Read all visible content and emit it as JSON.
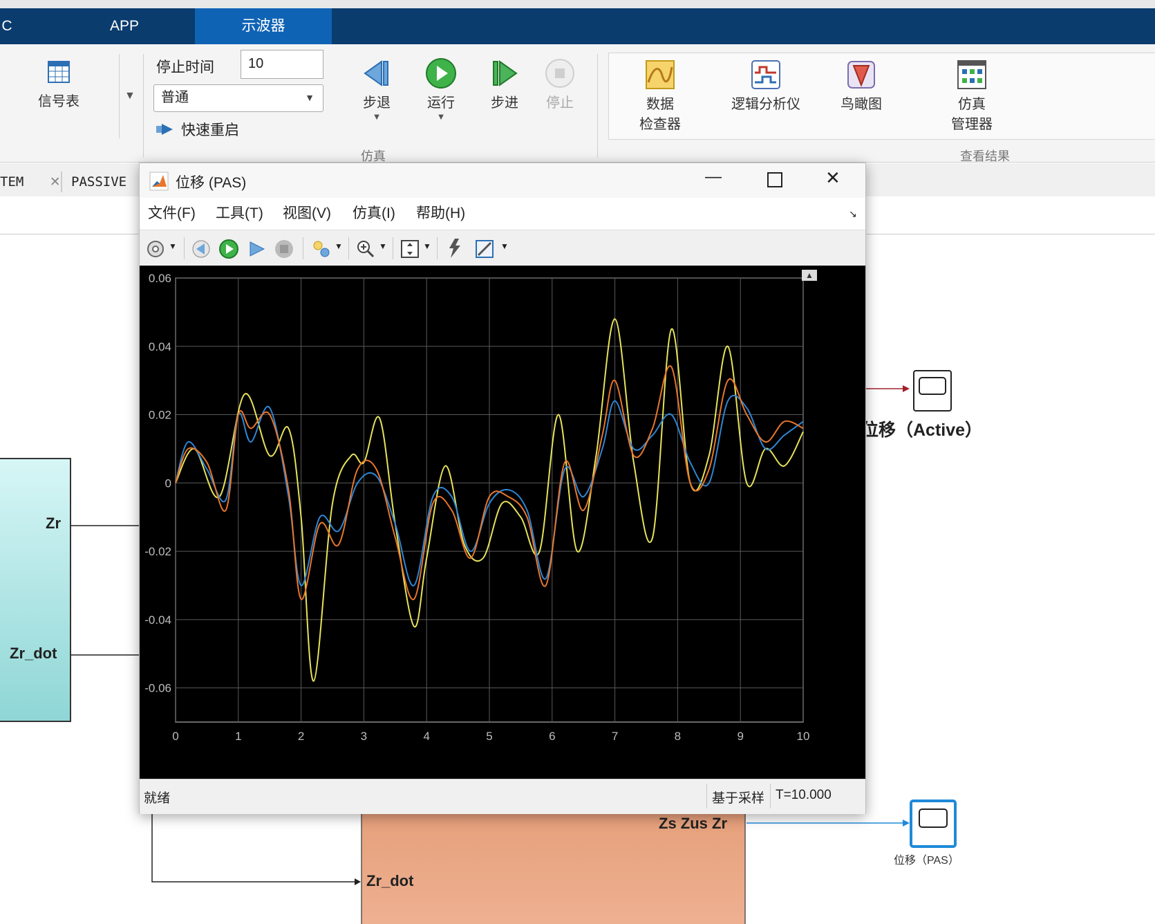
{
  "ribbon": {
    "tabs": [
      {
        "label": "C"
      },
      {
        "label": "APP"
      },
      {
        "label": "示波器",
        "active": true
      }
    ],
    "signal_table_label": "信号表",
    "stop_time_label": "停止时间",
    "stop_time_value": "10",
    "sim_mode_value": "普通",
    "fast_restart_label": "快速重启",
    "step_back_label": "步退",
    "run_label": "运行",
    "step_forward_label": "步进",
    "stop_label": "停止",
    "simulation_group_label": "仿真",
    "data_inspector_label_1": "数据",
    "data_inspector_label_2": "检查器",
    "logic_analyzer_label": "逻辑分析仪",
    "birds_eye_label": "鸟瞰图",
    "sim_manager_label_1": "仿真",
    "sim_manager_label_2": "管理器",
    "review_group_label": "查看结果"
  },
  "doc_tabs": [
    {
      "label": "TEM"
    },
    {
      "label": "PASSIVE"
    }
  ],
  "scope_window": {
    "title": "位移  (PAS)",
    "menu": [
      "文件(F)",
      "工具(T)",
      "视图(V)",
      "仿真(I)",
      "帮助(H)"
    ],
    "status_left": "就绪",
    "status_mode": "基于采样",
    "status_time": "T=10.000"
  },
  "diagram": {
    "block_left_port_1": "Zr",
    "block_left_port_2": "Zr_dot",
    "block_bottom_output": "Zs Zus Zr",
    "block_bottom_input": "Zr_dot",
    "scope_active_label": "位移（Active）",
    "scope_pas_label": "位移（PAS）"
  },
  "colors": {
    "ribbon_tab_bg": "#0b3c6e",
    "ribbon_tab_active": "#0f63b5",
    "plot_bg": "#000000",
    "series_blue": "#2f86d4",
    "series_orange": "#e8762c",
    "series_yellow": "#e6e35a",
    "block_teal": "#a8e4e4",
    "block_salmon": "#e6a07e"
  },
  "chart_data": {
    "type": "line",
    "title": "",
    "xlabel": "",
    "ylabel": "",
    "xlim": [
      0,
      10
    ],
    "ylim": [
      -0.07,
      0.06
    ],
    "xticks": [
      "0",
      "1",
      "2",
      "3",
      "4",
      "5",
      "6",
      "7",
      "8",
      "9",
      "10"
    ],
    "yticks": [
      "0.06",
      "0.04",
      "0.02",
      "0",
      "-0.02",
      "-0.04",
      "-0.06"
    ],
    "grid": true,
    "legend": "none",
    "series": [
      {
        "color": "#e6e35a",
        "x": [
          0,
          0.3,
          0.7,
          1.1,
          1.5,
          1.8,
          2.0,
          2.2,
          2.5,
          2.8,
          3.0,
          3.25,
          3.5,
          3.8,
          4.0,
          4.3,
          4.6,
          4.9,
          5.2,
          5.5,
          5.8,
          6.1,
          6.4,
          6.7,
          7.0,
          7.3,
          7.6,
          7.9,
          8.2,
          8.5,
          8.8,
          9.1,
          9.4,
          9.7,
          10.0
        ],
        "y": [
          0.0,
          0.01,
          -0.004,
          0.026,
          0.008,
          0.016,
          -0.01,
          -0.058,
          -0.006,
          0.008,
          0.006,
          0.019,
          -0.012,
          -0.042,
          -0.022,
          0.005,
          -0.018,
          -0.022,
          -0.006,
          -0.01,
          -0.02,
          0.02,
          -0.02,
          0.008,
          0.048,
          0.006,
          -0.016,
          0.045,
          0.0,
          0.008,
          0.04,
          0.0,
          0.01,
          0.005,
          0.015
        ]
      },
      {
        "color": "#2f86d4",
        "x": [
          0,
          0.2,
          0.5,
          0.8,
          1.0,
          1.2,
          1.5,
          1.8,
          2.0,
          2.3,
          2.6,
          2.9,
          3.2,
          3.5,
          3.8,
          4.1,
          4.4,
          4.7,
          5.0,
          5.3,
          5.6,
          5.9,
          6.2,
          6.5,
          6.8,
          7.0,
          7.3,
          7.6,
          7.9,
          8.2,
          8.5,
          8.8,
          9.1,
          9.4,
          9.7,
          10.0
        ],
        "y": [
          0.0,
          0.012,
          0.004,
          -0.005,
          0.02,
          0.012,
          0.022,
          -0.004,
          -0.03,
          -0.01,
          -0.014,
          0.0,
          0.002,
          -0.012,
          -0.03,
          -0.004,
          -0.004,
          -0.02,
          -0.006,
          -0.002,
          -0.008,
          -0.028,
          0.004,
          -0.004,
          0.01,
          0.024,
          0.01,
          0.014,
          0.02,
          0.006,
          0.0,
          0.024,
          0.022,
          0.01,
          0.014,
          0.018
        ]
      },
      {
        "color": "#e8762c",
        "x": [
          0,
          0.2,
          0.5,
          0.8,
          1.0,
          1.2,
          1.5,
          1.8,
          2.0,
          2.3,
          2.6,
          2.9,
          3.2,
          3.5,
          3.8,
          4.1,
          4.4,
          4.7,
          5.0,
          5.3,
          5.6,
          5.9,
          6.2,
          6.5,
          6.8,
          7.0,
          7.3,
          7.6,
          7.9,
          8.2,
          8.5,
          8.8,
          9.1,
          9.4,
          9.7,
          10.0
        ],
        "y": [
          0.0,
          0.01,
          0.006,
          -0.008,
          0.02,
          0.016,
          0.02,
          -0.002,
          -0.034,
          -0.012,
          -0.018,
          0.004,
          0.004,
          -0.016,
          -0.034,
          -0.006,
          -0.008,
          -0.022,
          -0.004,
          -0.004,
          -0.01,
          -0.03,
          0.006,
          -0.008,
          0.014,
          0.03,
          0.008,
          0.016,
          0.034,
          0.0,
          0.004,
          0.03,
          0.02,
          0.012,
          0.018,
          0.016
        ]
      }
    ]
  }
}
